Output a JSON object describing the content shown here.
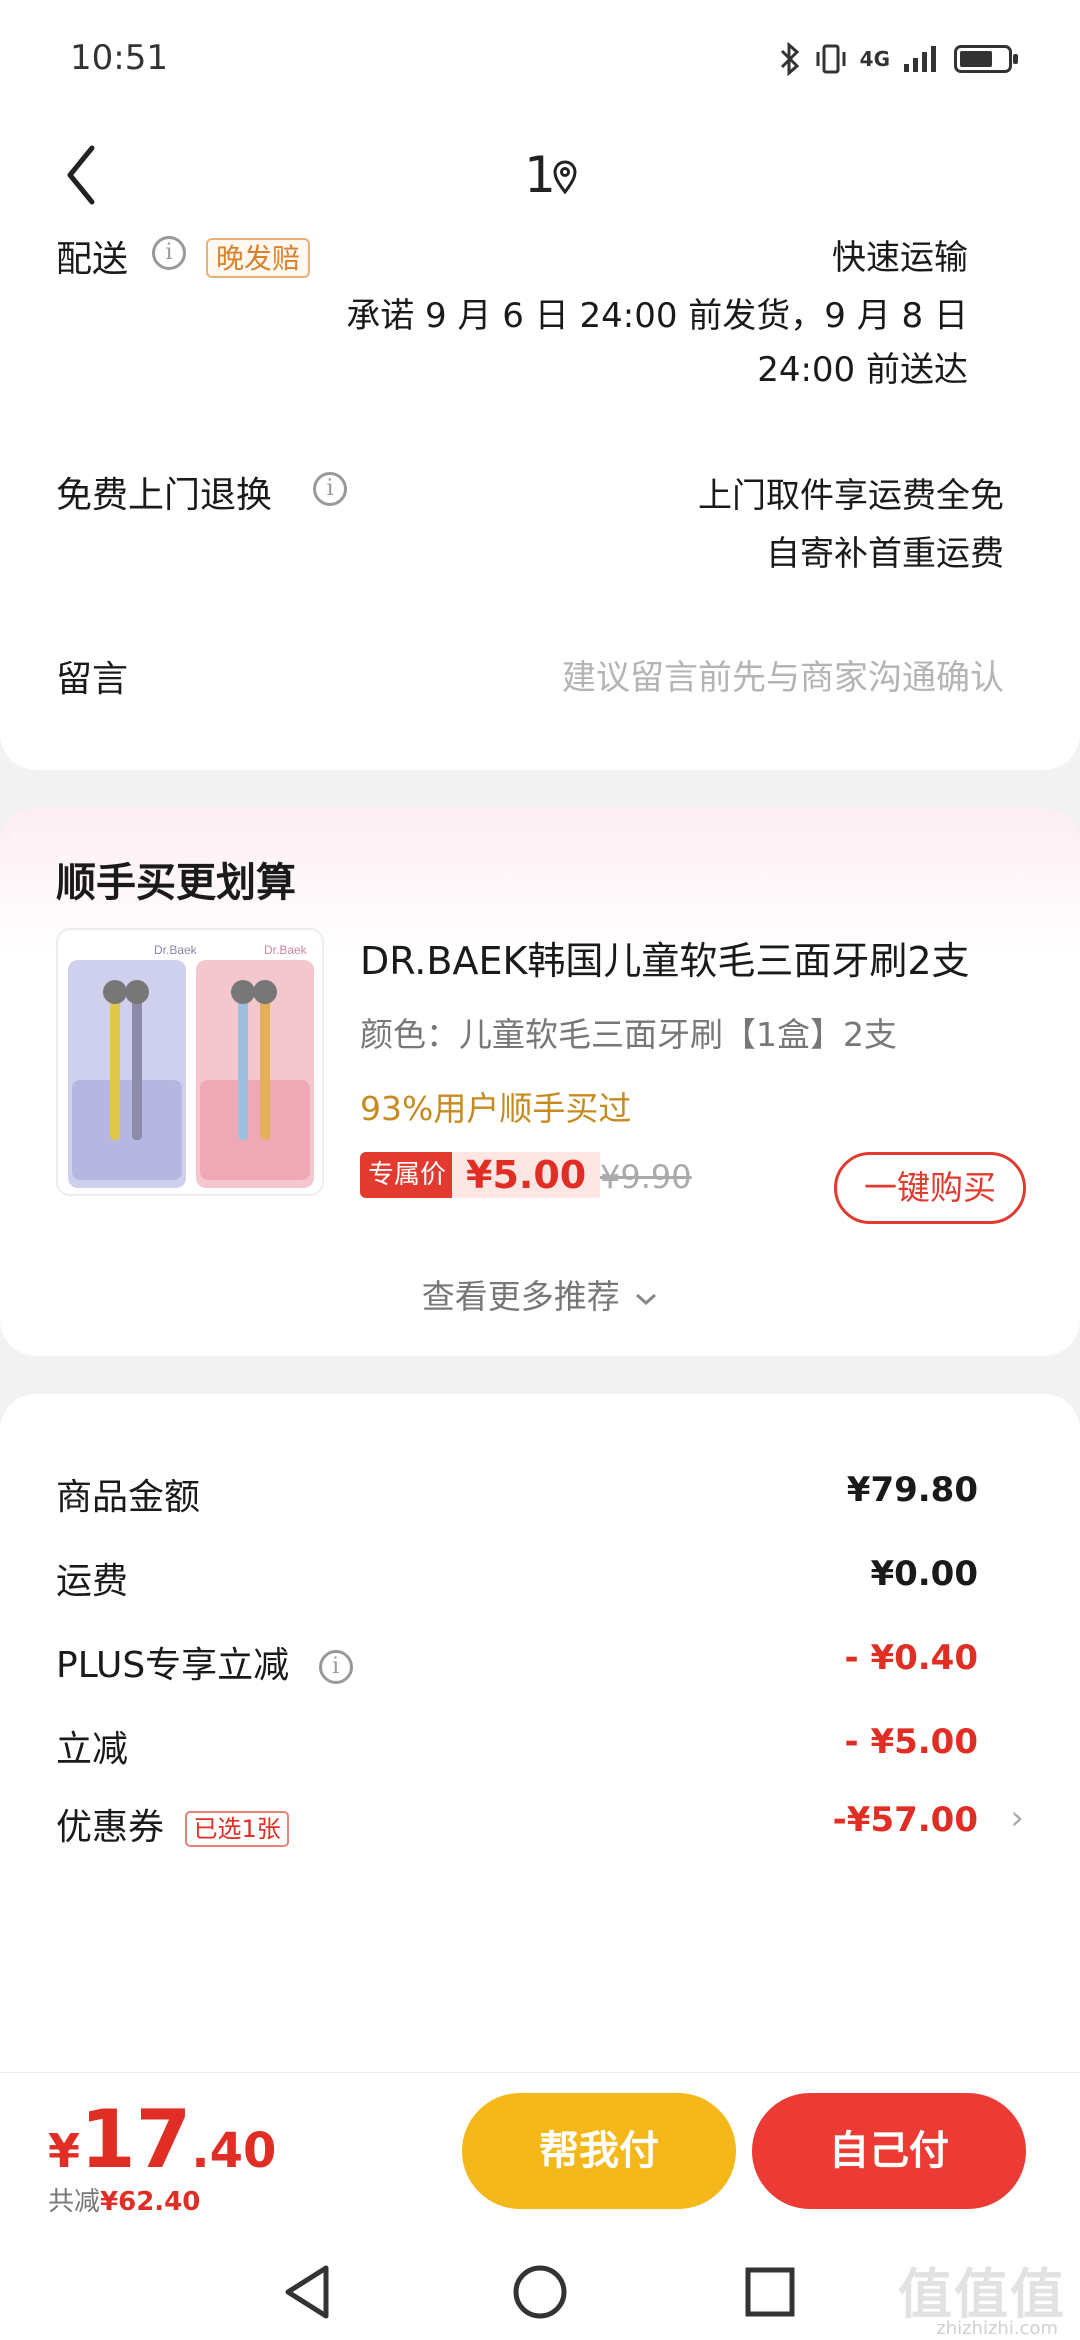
{
  "status_bar": {
    "time": "10:51",
    "network": "4G"
  },
  "nav": {
    "title": "1"
  },
  "delivery": {
    "label": "配送",
    "late_tag": "晚发赔",
    "method": "快速运输",
    "promise_line1": "承诺 9 月 6 日 24:00 前发货，9 月 8 日",
    "promise_line2": "24:00 前送达"
  },
  "return": {
    "label": "免费上门退换",
    "line1": "上门取件享运费全免",
    "line2": "自寄补首重运费"
  },
  "message": {
    "label": "留言",
    "placeholder": "建议留言前先与商家沟通确认"
  },
  "recommend": {
    "section_title": "顺手买更划算",
    "product_title": "DR.BAEK韩国儿童软毛三面牙刷2支",
    "product_spec": "颜色：儿童软毛三面牙刷【1盒】2支",
    "buy_stat": "93%用户顺手买过",
    "price_tag": "专属价",
    "price": "¥5.00",
    "old_price": "¥9.90",
    "buy_button": "一键购买",
    "more_link": "查看更多推荐",
    "thumb_brand": "Dr.Baek"
  },
  "amounts": {
    "goods_label": "商品金额",
    "goods_value": "¥79.80",
    "shipping_label": "运费",
    "shipping_value": "¥0.00",
    "plus_label": "PLUS专享立减",
    "plus_value": "- ¥0.40",
    "instant_label": "立减",
    "instant_value": "- ¥5.00",
    "coupon_label": "优惠券",
    "coupon_badge": "已选1张",
    "coupon_value": "-¥57.00"
  },
  "bottom": {
    "currency": "¥",
    "total_int": "17",
    "total_dec": ".40",
    "saved_prefix": "共减",
    "saved_value": "¥62.40",
    "help_button": "帮我付",
    "self_button": "自己付"
  },
  "watermark": {
    "main": "值值值",
    "sub": "zhizhizhi.com"
  },
  "colors": {
    "accent_red": "#e02e24",
    "help_yellow": "#f5b81b",
    "pay_red": "#ec3b35",
    "stat_gold": "#c68a1f"
  }
}
